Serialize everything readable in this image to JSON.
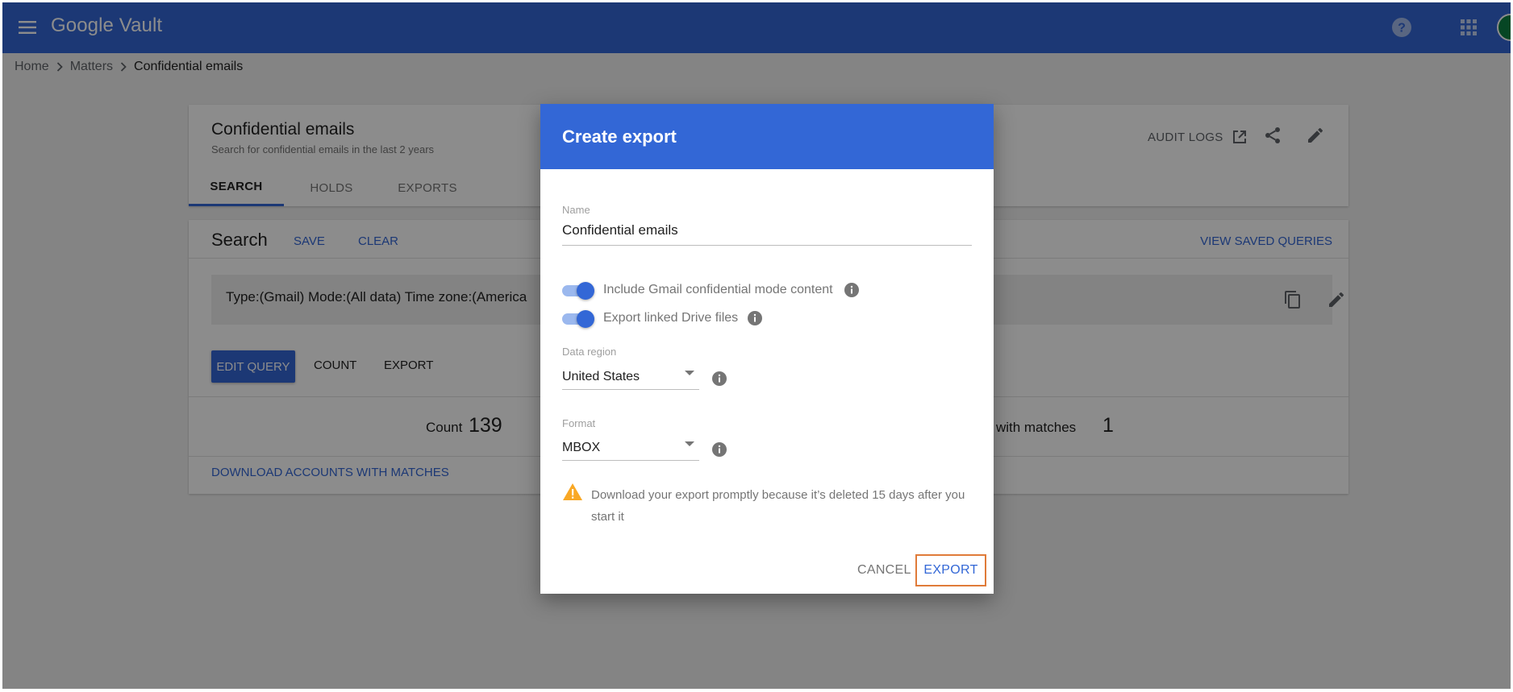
{
  "app": {
    "name": "Google Vault"
  },
  "breadcrumb": {
    "items": [
      "Home",
      "Matters",
      "Confidential emails"
    ]
  },
  "matter": {
    "title": "Confidential emails",
    "subtitle": "Search for confidential emails in the last 2 years",
    "tabs": [
      {
        "label": "SEARCH",
        "active": true
      },
      {
        "label": "HOLDS",
        "active": false
      },
      {
        "label": "EXPORTS",
        "active": false
      }
    ],
    "audit_logs_label": "AUDIT LOGS"
  },
  "search": {
    "heading": "Search",
    "save_label": "SAVE",
    "clear_label": "CLEAR",
    "saved_queries_label": "VIEW SAVED QUERIES",
    "query_text": "Type:(Gmail) Mode:(All data) Time zone:(America",
    "edit_query_label": "EDIT QUERY",
    "count_label": "COUNT",
    "export_label": "EXPORT",
    "results": {
      "count_label": "Count",
      "count_value": "139",
      "matches_label": "ts with matches",
      "matches_value": "1"
    },
    "download_label": "DOWNLOAD ACCOUNTS WITH MATCHES"
  },
  "dialog": {
    "title": "Create export",
    "name_label": "Name",
    "name_value": "Confidential emails",
    "toggles": [
      {
        "label": "Include Gmail confidential mode content",
        "on": true
      },
      {
        "label": "Export linked Drive files",
        "on": true
      }
    ],
    "data_region_label": "Data region",
    "data_region_value": "United States",
    "format_label": "Format",
    "format_value": "MBOX",
    "warning_text": "Download your export promptly because it’s deleted 15 days after you start it",
    "cancel_label": "CANCEL",
    "export_label": "EXPORT"
  },
  "colors": {
    "brand": "#3367d6",
    "highlight": "#e07b39",
    "warning": "#f9a825"
  }
}
